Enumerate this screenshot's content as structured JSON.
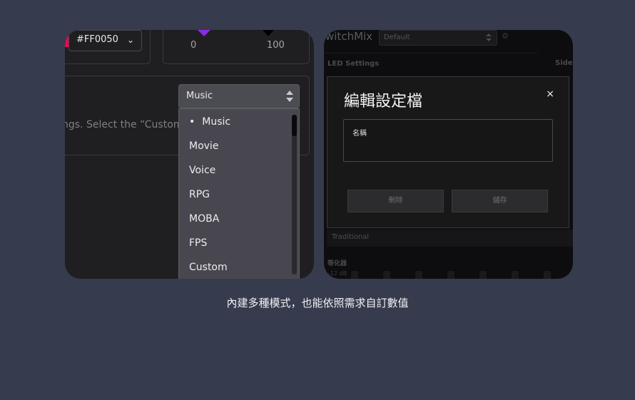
{
  "left_panel": {
    "color_value": "#FF0050",
    "color_chevron": "chevron-down-icon",
    "slider_min": "0",
    "slider_max": "100",
    "mode_selected": "Music",
    "hint_text": "ngs. Select the “Custom”",
    "dropdown_options": [
      "Music",
      "Movie",
      "Voice",
      "RPG",
      "MOBA",
      "FPS",
      "Custom"
    ],
    "selected_bullet": "•",
    "accent_color": "#ff0050",
    "slider_accent": "#8a2be2"
  },
  "right_panel": {
    "app_title": "witchMix",
    "profile_value": "Default",
    "section_led": "LED Settings",
    "section_side": "Sidet",
    "modal": {
      "title": "編輯設定檔",
      "close": "×",
      "field_label": "名稱",
      "delete_label": "刪除",
      "save_label": "儲存"
    },
    "behind_text": "Traditional",
    "eq_label": "等化器",
    "eq_db": "-12 dB"
  },
  "caption": "內建多種模式，也能依照需求自訂數值"
}
